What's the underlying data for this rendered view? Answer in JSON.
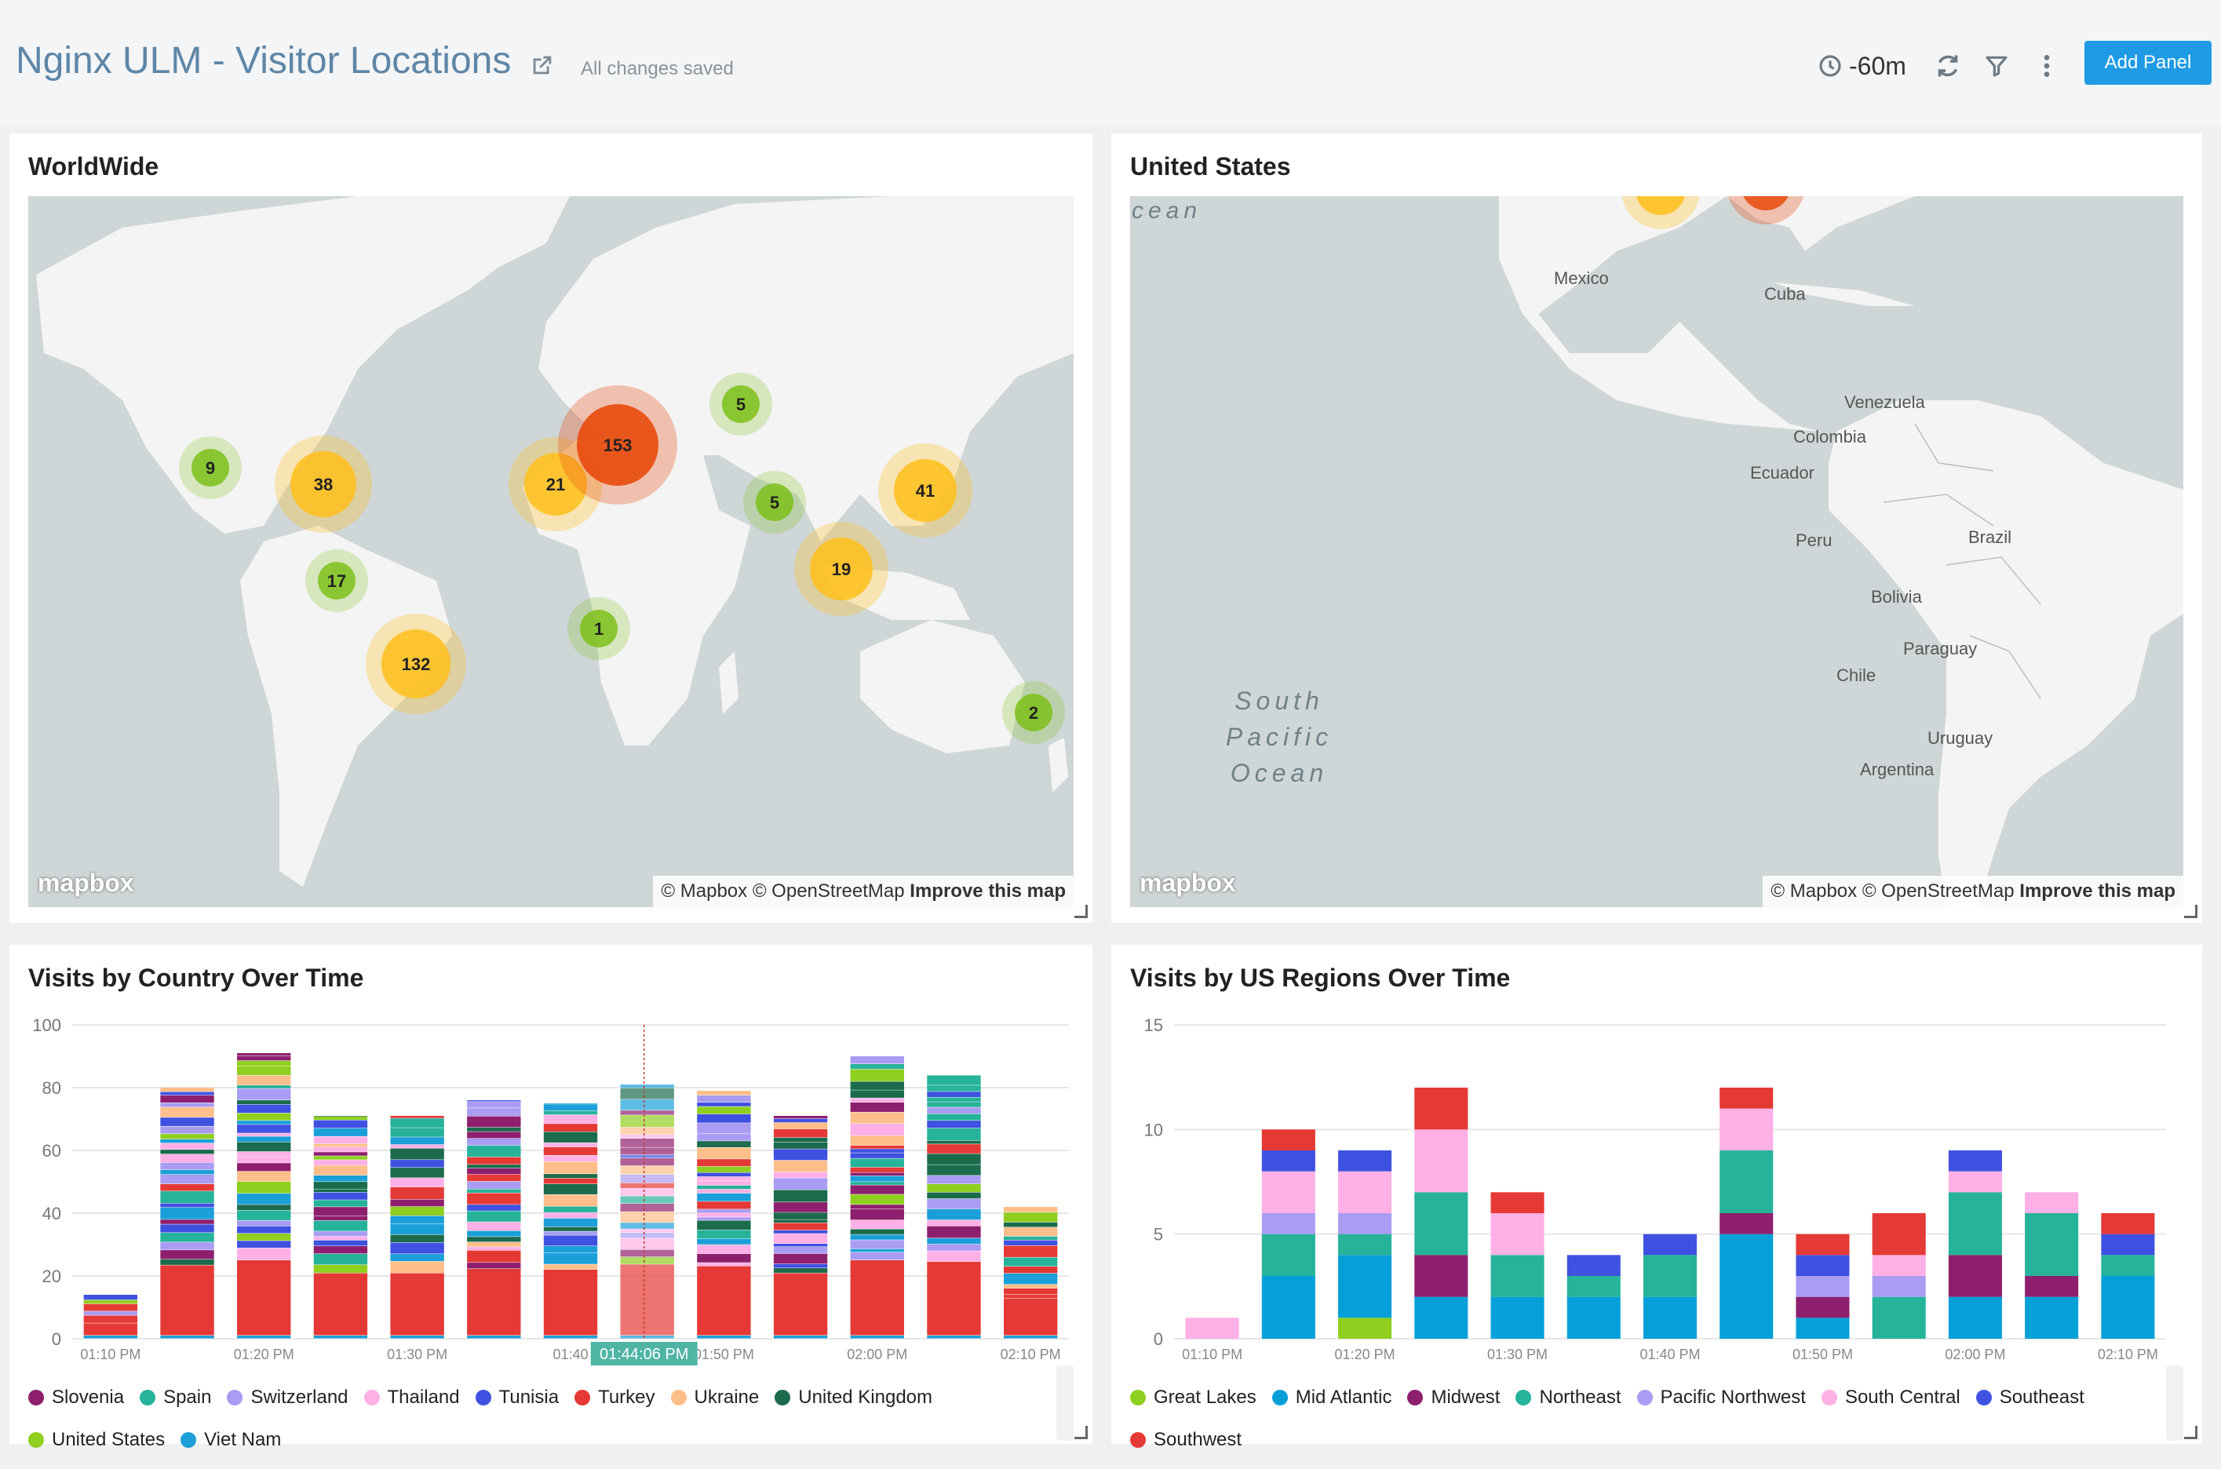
{
  "header": {
    "title": "Nginx ULM - Visitor Locations",
    "saved_status": "All changes saved",
    "time_range": "-60m",
    "add_panel_label": "Add Panel",
    "icons": [
      "share-icon",
      "clock-icon",
      "refresh-icon",
      "filter-icon",
      "more-icon"
    ]
  },
  "panels": {
    "worldwide": {
      "title": "WorldWide",
      "logo": "mapbox",
      "attribution": {
        "text": "© Mapbox © OpenStreetMap",
        "link": "Improve this map"
      },
      "clusters": [
        {
          "label": "9",
          "color": "#7cbf1a"
        },
        {
          "label": "38",
          "color": "#ffbf1a"
        },
        {
          "label": "17",
          "color": "#7cbf1a"
        },
        {
          "label": "132",
          "color": "#ffbf1a"
        },
        {
          "label": "21",
          "color": "#ffbf1a"
        },
        {
          "label": "153",
          "color": "#e84a0c"
        },
        {
          "label": "5",
          "color": "#7cbf1a"
        },
        {
          "label": "5",
          "color": "#7cbf1a"
        },
        {
          "label": "41",
          "color": "#ffbf1a"
        },
        {
          "label": "19",
          "color": "#ffbf1a"
        },
        {
          "label": "1",
          "color": "#7cbf1a"
        },
        {
          "label": "2",
          "color": "#7cbf1a"
        }
      ]
    },
    "united_states": {
      "title": "United States",
      "logo": "mapbox",
      "attribution": {
        "text": "© Mapbox © OpenStreetMap",
        "link": "Improve this map"
      },
      "places": [
        "Mexico",
        "Cuba",
        "Venezuela",
        "Colombia",
        "Ecuador",
        "Peru",
        "Brazil",
        "Bolivia",
        "Paraguay",
        "Chile",
        "Uruguay",
        "Argentina"
      ],
      "ocean_top": "cean",
      "ocean_lines": [
        "South",
        "Pacific",
        "Ocean"
      ]
    },
    "country_chart": {
      "title": "Visits by Country Over Time"
    },
    "region_chart": {
      "title": "Visits by US Regions Over Time"
    }
  },
  "chart_data": [
    {
      "type": "bar",
      "stacked": true,
      "title": "Visits by Country Over Time",
      "x": [
        "01:10 PM",
        "01:15 PM",
        "01:20 PM",
        "01:25 PM",
        "01:30 PM",
        "01:35 PM",
        "01:40 PM",
        "01:45 PM",
        "01:50 PM",
        "01:55 PM",
        "02:00 PM",
        "02:05 PM",
        "02:10 PM"
      ],
      "xtick_labels": [
        "01:10 PM",
        "01:20 PM",
        "01:30 PM",
        "01:40",
        "01:50 PM",
        "02:00 PM",
        "02:10 PM"
      ],
      "hover_label": "01:44:06 PM",
      "hover_index": 7,
      "ylim": [
        0,
        100
      ],
      "yticks": [
        0,
        20,
        40,
        60,
        80,
        100
      ],
      "totals": [
        14,
        80,
        91,
        71,
        71,
        76,
        75,
        81,
        79,
        71,
        90,
        84,
        42
      ],
      "series": [
        {
          "name": "Slovenia",
          "color": "#8e1f6e"
        },
        {
          "name": "Spain",
          "color": "#26b39a"
        },
        {
          "name": "Switzerland",
          "color": "#a99cf2"
        },
        {
          "name": "Thailand",
          "color": "#ffb0e6"
        },
        {
          "name": "Tunisia",
          "color": "#3f51e0"
        },
        {
          "name": "Turkey",
          "color": "#e53935"
        },
        {
          "name": "Ukraine",
          "color": "#ffbe8a"
        },
        {
          "name": "United Kingdom",
          "color": "#1b6b4c"
        },
        {
          "name": "United States",
          "color": "#8fcf1f"
        },
        {
          "name": "Viet Nam",
          "color": "#1b9fd8"
        }
      ]
    },
    {
      "type": "bar",
      "stacked": true,
      "title": "Visits by US Regions Over Time",
      "x": [
        "01:10 PM",
        "01:15 PM",
        "01:20 PM",
        "01:25 PM",
        "01:30 PM",
        "01:35 PM",
        "01:40 PM",
        "01:45 PM",
        "01:50 PM",
        "01:55 PM",
        "02:00 PM",
        "02:05 PM",
        "02:10 PM"
      ],
      "xtick_labels": [
        "01:10 PM",
        "01:20 PM",
        "01:30 PM",
        "01:40 PM",
        "01:50 PM",
        "02:00 PM",
        "02:10 PM"
      ],
      "ylim": [
        0,
        15
      ],
      "yticks": [
        0,
        5,
        10,
        15
      ],
      "series": [
        {
          "name": "Great Lakes",
          "color": "#8fcf1f",
          "values": [
            0,
            0,
            1,
            0,
            0,
            0,
            0,
            0,
            0,
            0,
            0,
            0,
            0
          ]
        },
        {
          "name": "Mid Atlantic",
          "color": "#05a0d8",
          "values": [
            0,
            3,
            3,
            2,
            2,
            2,
            2,
            5,
            1,
            0,
            2,
            2,
            3
          ]
        },
        {
          "name": "Midwest",
          "color": "#8e1f6e",
          "values": [
            0,
            0,
            0,
            2,
            0,
            0,
            0,
            1,
            1,
            0,
            2,
            1,
            0
          ]
        },
        {
          "name": "Northeast",
          "color": "#26b39a",
          "values": [
            0,
            2,
            1,
            3,
            2,
            1,
            2,
            3,
            0,
            2,
            3,
            3,
            1
          ]
        },
        {
          "name": "Pacific Northwest",
          "color": "#a99cf2",
          "values": [
            0,
            1,
            1,
            0,
            0,
            0,
            0,
            0,
            1,
            1,
            0,
            0,
            0
          ]
        },
        {
          "name": "South Central",
          "color": "#ffb0e6",
          "values": [
            1,
            2,
            2,
            3,
            2,
            0,
            0,
            2,
            0,
            1,
            1,
            1,
            0
          ]
        },
        {
          "name": "Southeast",
          "color": "#3f51e0",
          "values": [
            0,
            1,
            1,
            0,
            0,
            1,
            1,
            0,
            1,
            0,
            1,
            0,
            1
          ]
        },
        {
          "name": "Southwest",
          "color": "#e53935",
          "values": [
            0,
            1,
            0,
            2,
            1,
            0,
            0,
            1,
            1,
            2,
            0,
            0,
            1
          ]
        }
      ]
    }
  ]
}
